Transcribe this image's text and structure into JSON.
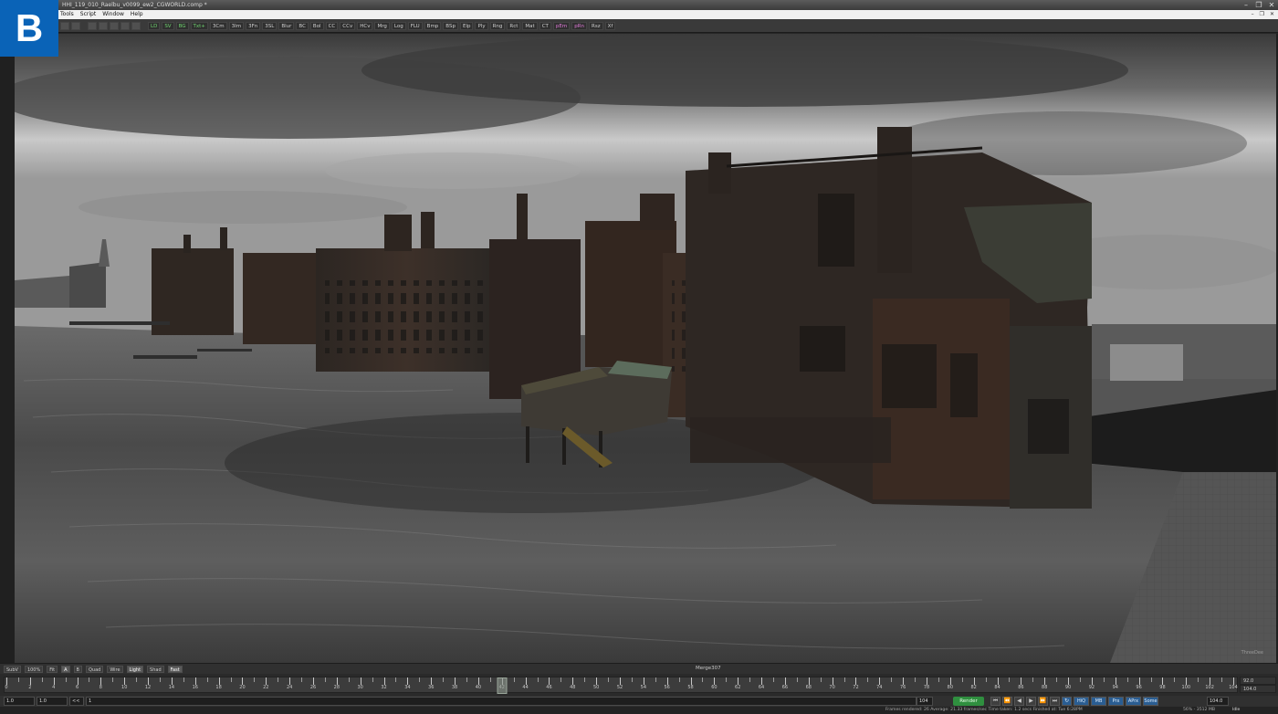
{
  "badge": "B",
  "window": {
    "title": "HHI_119_010_Raelbu_v0099_ew2_CGWORLD.comp *",
    "controls": [
      "–",
      "❐",
      "✕"
    ]
  },
  "menu": {
    "items": [
      "Tools",
      "Script",
      "Window",
      "Help"
    ],
    "mdi_controls": [
      "–",
      "❐",
      "✕"
    ]
  },
  "toolbar": {
    "tools": [
      "LD",
      "SV",
      "BG",
      "Txt+",
      "3Cm",
      "3Im",
      "3Fn",
      "3SL",
      "Blur",
      "BC",
      "Bol",
      "CC",
      "CCv",
      "HCv",
      "Mrg",
      "Log",
      "FLU",
      "Bmp",
      "BSp",
      "Elp",
      "Ply",
      "Rng",
      "Rct",
      "Mat",
      "CT",
      "pEm",
      "pRn",
      "Rsz",
      "Xf"
    ],
    "green_tools": [
      "LD",
      "SV",
      "BG",
      "Txt+"
    ],
    "pink_tools": [
      "pEm",
      "pRn"
    ]
  },
  "viewer": {
    "left_controls": [
      "SubV",
      "100%",
      "Fit",
      "A",
      "B",
      "Quad",
      "Wire",
      "Light",
      "Shad",
      "Fast"
    ],
    "active_controls": [
      "A",
      "Light",
      "Fast"
    ],
    "center_label": "Merge307",
    "watermark": "ThreeDee"
  },
  "timeline": {
    "labels": [
      "0",
      "2",
      "4",
      "6",
      "8",
      "10",
      "12",
      "14",
      "16",
      "18",
      "20",
      "22",
      "24",
      "26",
      "28",
      "30",
      "32",
      "34",
      "36",
      "38",
      "40",
      "42",
      "44",
      "46",
      "48",
      "50",
      "52",
      "54",
      "56",
      "58",
      "60",
      "62",
      "64",
      "66",
      "68",
      "70",
      "72",
      "74",
      "76",
      "78",
      "80",
      "82",
      "84",
      "86",
      "88",
      "90",
      "92",
      "94",
      "96",
      "98",
      "100",
      "102",
      "104"
    ],
    "current_frame": "42",
    "render_end": "92.0",
    "global_end": "104.0"
  },
  "transport": {
    "start": "1.0",
    "render_start": "1.0",
    "prev_label": "<<",
    "current": "1",
    "end_field": "104",
    "render_label": "Render",
    "buttons": [
      "⏮",
      "⏪",
      "◀",
      "▶",
      "⏩",
      "⏭",
      "↻"
    ],
    "extra_buttons": [
      "HiQ",
      "MB",
      "Prx",
      "APrx",
      "Some"
    ],
    "end_value": "104.0"
  },
  "status": {
    "stats": "Frames rendered: 26  Average: 21.33 frames/sec  Time taken: 1.2 secs  Finished at: Tue 6:28PM",
    "mem": "56% - 3512 MB",
    "idle": "Idle"
  },
  "colors": {
    "badge": "#0a63b7",
    "render_button": "#2f8f3f",
    "toolbar_green": "#6fd36f",
    "toolbar_pink": "#e07ad8"
  }
}
